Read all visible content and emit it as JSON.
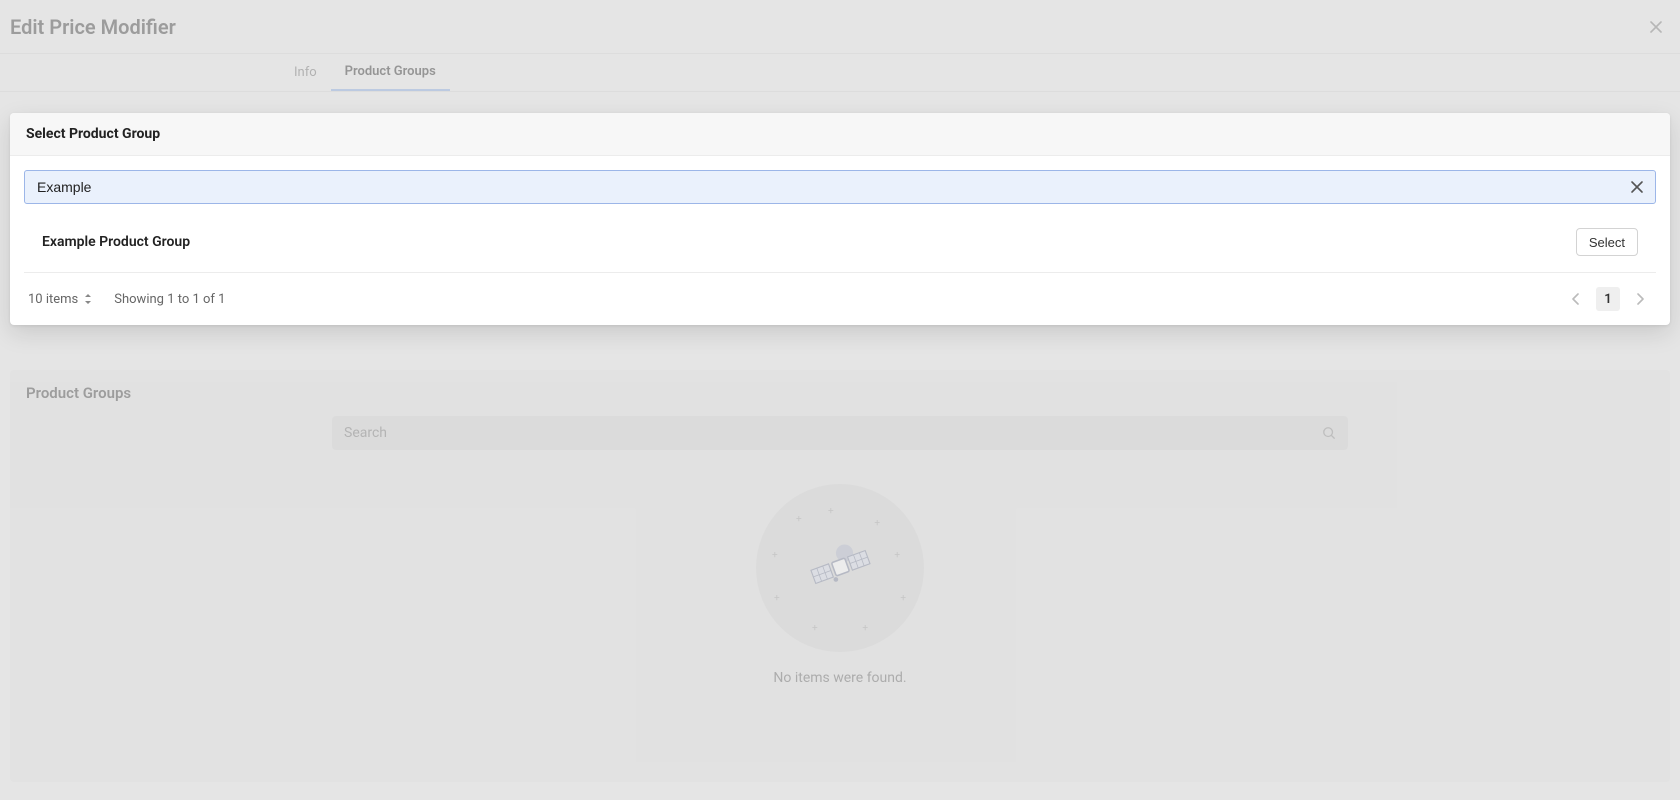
{
  "header": {
    "title": "Edit Price Modifier"
  },
  "tabs": {
    "info": "Info",
    "productGroups": "Product Groups"
  },
  "modal": {
    "title": "Select Product Group",
    "search_value": "Example",
    "results": [
      {
        "name": "Example Product Group",
        "select_label": "Select"
      }
    ],
    "footer": {
      "items_label": "10 items",
      "showing_label": "Showing 1 to 1 of 1",
      "page": "1"
    }
  },
  "background_section": {
    "title": "Product Groups",
    "search_placeholder": "Search",
    "empty_text": "No items were found."
  }
}
